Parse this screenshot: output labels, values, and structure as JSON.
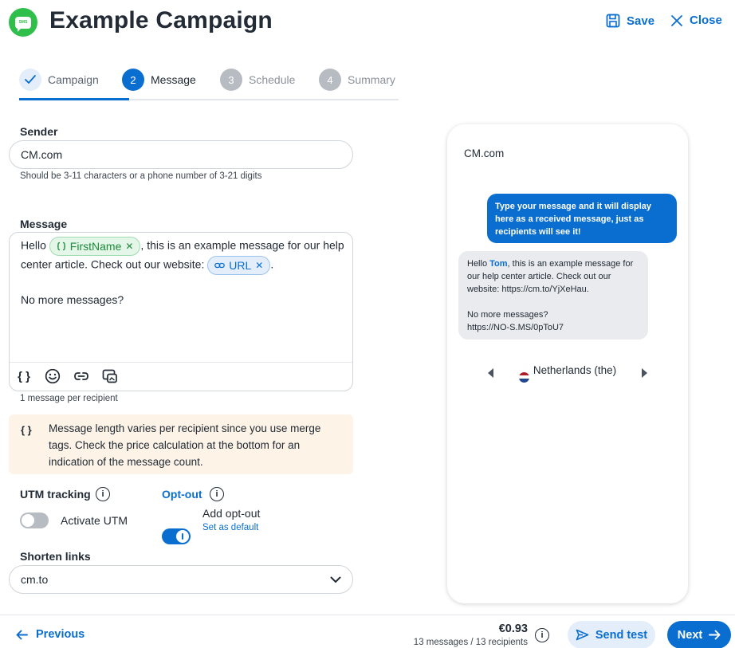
{
  "header": {
    "logo_text": "SMS",
    "title": "Example Campaign",
    "save_label": "Save",
    "close_label": "Close"
  },
  "stepper": {
    "steps": [
      {
        "number": "1",
        "label": "Campaign",
        "state": "done"
      },
      {
        "number": "2",
        "label": "Message",
        "state": "active"
      },
      {
        "number": "3",
        "label": "Schedule",
        "state": "todo"
      },
      {
        "number": "4",
        "label": "Summary",
        "state": "todo"
      }
    ]
  },
  "sender": {
    "label": "Sender",
    "value": "CM.com",
    "hint": "Should be 3-11 characters or a phone number of 3-21 digits"
  },
  "message": {
    "label": "Message",
    "text_part1": "Hello",
    "tag_firstname": "FirstName",
    "text_part2": ", this is an example message for our help center article. Check out our website:",
    "tag_url": "URL",
    "text_part3": ".",
    "line2": "No more messages?",
    "count_hint": "1 message per recipient",
    "tools": [
      "merge-tag-icon",
      "emoji-icon",
      "link-icon",
      "media-icon"
    ]
  },
  "merge_info": {
    "icon": "{ }",
    "text": "Message length varies per recipient since you use merge tags. Check the price calculation at the bottom for an indication of the message count."
  },
  "utm": {
    "label": "UTM tracking",
    "toggle_label": "Activate UTM",
    "enabled": false
  },
  "optout": {
    "label": "Opt-out",
    "toggle_label": "Add opt-out",
    "default_link": "Set as default",
    "enabled": true
  },
  "shorten": {
    "label": "Shorten links",
    "selected": "cm.to"
  },
  "preview": {
    "sender": "CM.com",
    "outgoing": "Type your message and it will display here as a received message, just as recipients will see it!",
    "incoming_hello": "Hello ",
    "incoming_name": "Tom",
    "incoming_rest": ", this is an example message for our help center article. Check out our website: https://cm.to/YjXeHau.",
    "incoming_line2": "No more messages?",
    "incoming_line3": "https://NO-S.MS/0pToU7",
    "country": "Netherlands (the)"
  },
  "footer": {
    "previous_label": "Previous",
    "price": "€0.93",
    "price_detail": "13 messages / 13 recipients",
    "send_test_label": "Send test",
    "next_label": "Next"
  },
  "colors": {
    "accent": "#0a6ed1",
    "brand_green": "#2fbf4a",
    "info_bg": "#fdf3e6"
  }
}
